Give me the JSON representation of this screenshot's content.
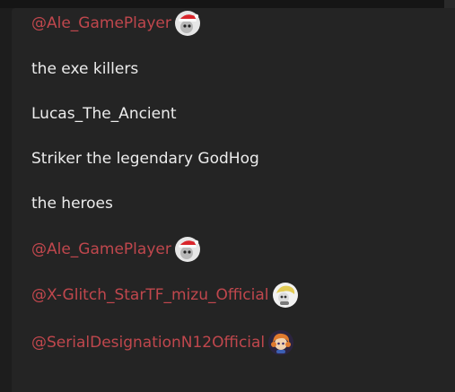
{
  "lines": [
    {
      "kind": "mention",
      "text": "@Ale_GamePlayer",
      "avatar": "santa-hat-avatar-icon"
    },
    {
      "kind": "text",
      "text": "the exe killers"
    },
    {
      "kind": "text",
      "text": "Lucas_The_Ancient"
    },
    {
      "kind": "text",
      "text": "Striker the legendary GodHog"
    },
    {
      "kind": "text",
      "text": "the heroes"
    },
    {
      "kind": "mention",
      "text": "@Ale_GamePlayer",
      "avatar": "santa-hat-avatar-icon"
    },
    {
      "kind": "mention",
      "text": "@X-Glitch_StarTF_mizu_Official",
      "avatar": "yellow-hair-avatar-icon"
    },
    {
      "kind": "mention",
      "text": "@SerialDesignationN12Official",
      "avatar": "orange-hair-avatar-icon"
    }
  ],
  "colors": {
    "background": "#1d1d1d",
    "panel": "#242424",
    "text": "#ececec",
    "mention": "#c0474d"
  }
}
